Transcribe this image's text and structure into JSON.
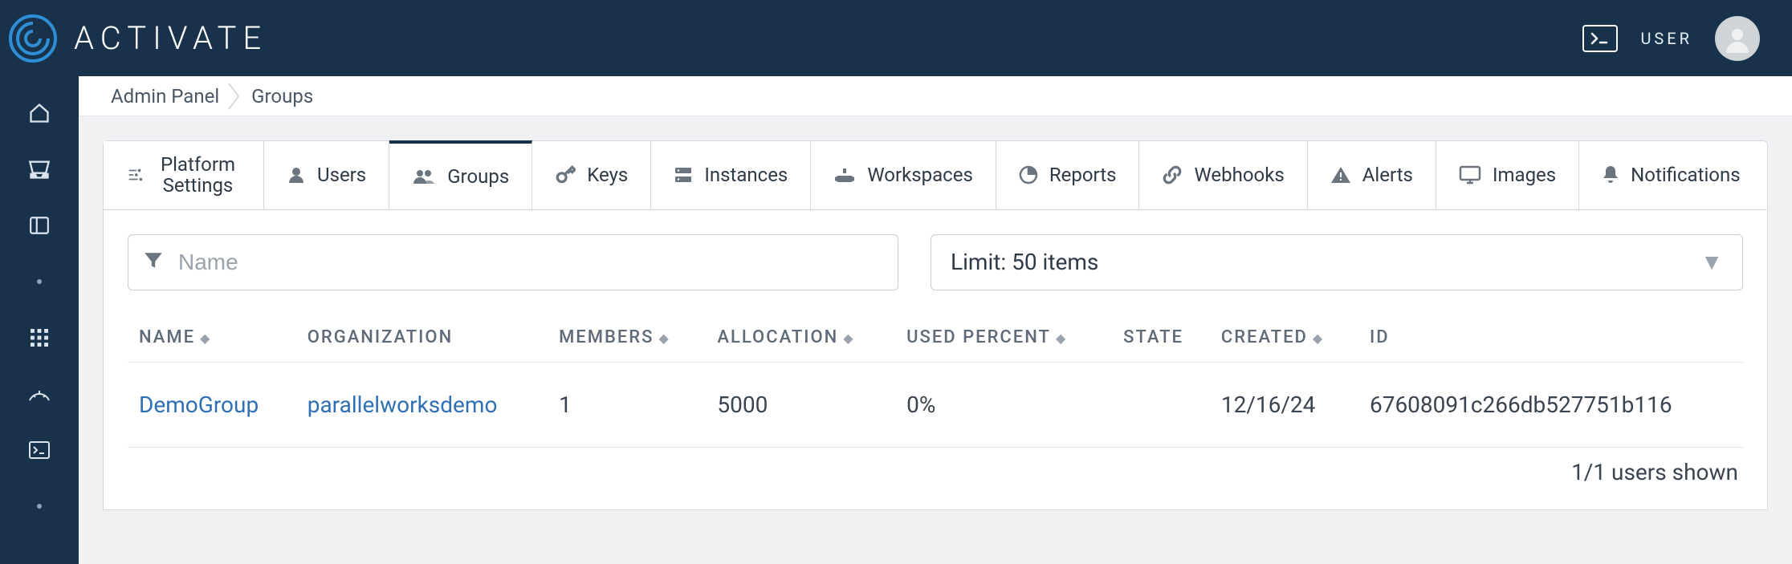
{
  "brand": {
    "name": "ACTIVATE"
  },
  "header": {
    "terminal_icon": "terminal",
    "user_label": "USER"
  },
  "breadcrumbs": {
    "items": [
      "Admin Panel",
      "Groups"
    ]
  },
  "tabs": {
    "items": [
      {
        "label": "Platform Settings",
        "icon": "settings"
      },
      {
        "label": "Users",
        "icon": "user"
      },
      {
        "label": "Groups",
        "icon": "group"
      },
      {
        "label": "Keys",
        "icon": "key"
      },
      {
        "label": "Instances",
        "icon": "server"
      },
      {
        "label": "Workspaces",
        "icon": "workspace"
      },
      {
        "label": "Reports",
        "icon": "pie"
      },
      {
        "label": "Webhooks",
        "icon": "link"
      },
      {
        "label": "Alerts",
        "icon": "alert"
      },
      {
        "label": "Images",
        "icon": "monitor"
      },
      {
        "label": "Notifications",
        "icon": "bell"
      }
    ],
    "active_index": 2
  },
  "filters": {
    "search_placeholder": "Name",
    "limit_label": "Limit: 50 items"
  },
  "table": {
    "columns": [
      {
        "label": "NAME",
        "sortable": true
      },
      {
        "label": "ORGANIZATION",
        "sortable": false
      },
      {
        "label": "MEMBERS",
        "sortable": true
      },
      {
        "label": "ALLOCATION",
        "sortable": true
      },
      {
        "label": "USED PERCENT",
        "sortable": true
      },
      {
        "label": "STATE",
        "sortable": false
      },
      {
        "label": "CREATED",
        "sortable": true
      },
      {
        "label": "ID",
        "sortable": false
      }
    ],
    "rows": [
      {
        "name": "DemoGroup",
        "organization": "parallelworksdemo",
        "members": "1",
        "allocation": "5000",
        "used_percent": "0%",
        "state": "",
        "created": "12/16/24",
        "id": "67608091c266db527751b116"
      }
    ],
    "footer": "1/1 users shown"
  },
  "leftnav": {
    "items": [
      "home",
      "inbox",
      "panel",
      "dot",
      "grid",
      "gauge",
      "terminal",
      "dot"
    ]
  }
}
